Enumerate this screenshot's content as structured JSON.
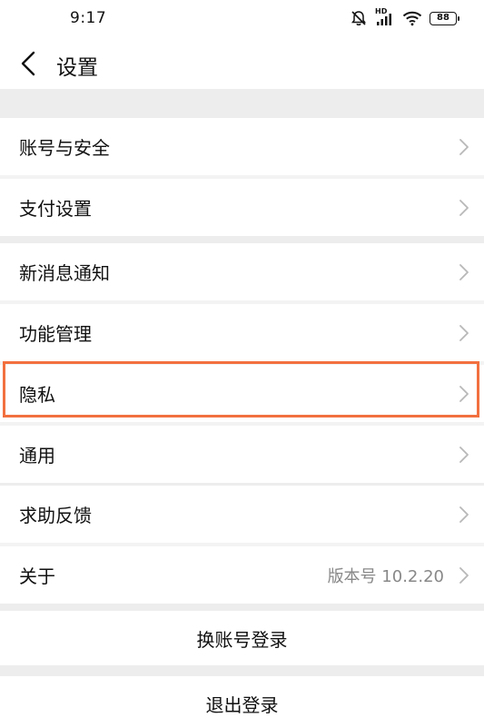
{
  "status_bar": {
    "time": "9:17",
    "icons": [
      "bell-off-icon",
      "hd-signal-icon",
      "wifi-icon",
      "battery-icon"
    ],
    "hd_label": "HD",
    "battery_level": "88"
  },
  "nav": {
    "back_icon": "chevron-left-icon",
    "title": "设置"
  },
  "groups": {
    "account": [
      {
        "label": "账号与安全"
      },
      {
        "label": "支付设置"
      }
    ],
    "general": [
      {
        "label": "新消息通知"
      },
      {
        "label": "功能管理"
      },
      {
        "label": "隐私"
      },
      {
        "label": "通用"
      }
    ],
    "support": [
      {
        "label": "求助反馈"
      },
      {
        "label": "关于",
        "value": "版本号 10.2.20"
      }
    ]
  },
  "actions": {
    "switch_account": "换账号登录",
    "logout": "退出登录"
  },
  "colors": {
    "highlight": "#f2703f",
    "background": "#ededed",
    "chevron": "#b8b8b8"
  }
}
